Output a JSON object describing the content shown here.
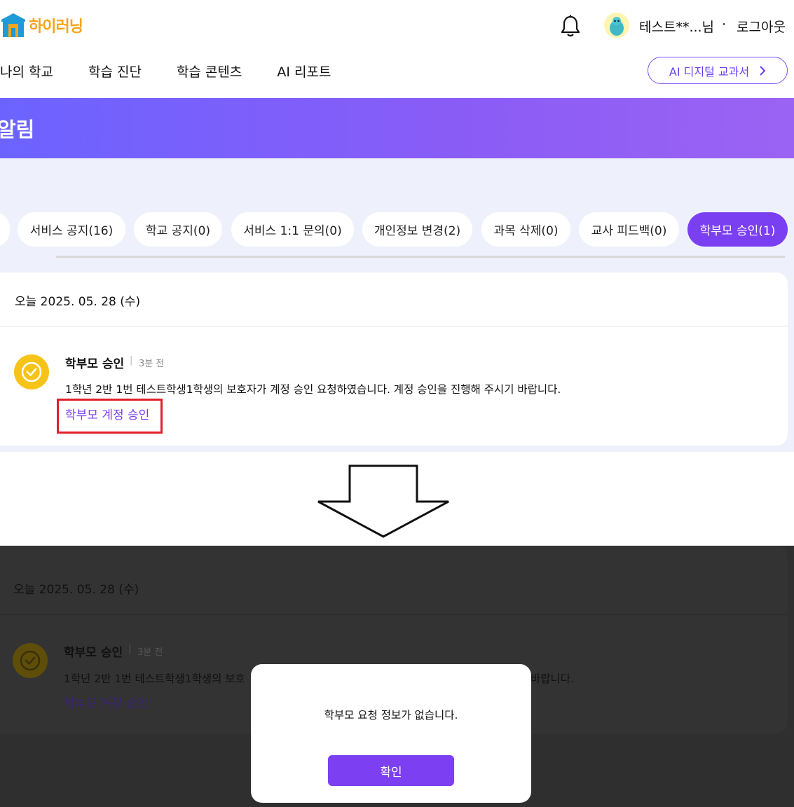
{
  "header": {
    "logo_text": "하이러닝",
    "user_name": "테스트**...님",
    "separator": "·",
    "logout_label": "로그아웃"
  },
  "nav": {
    "items": [
      "나의 학교",
      "학습 진단",
      "학습 콘텐츠",
      "AI 리포트"
    ],
    "ai_textbook_label": "AI 디지털 교과서"
  },
  "banner": {
    "title": "알림"
  },
  "tabs": [
    {
      "label": "서비스 공지(16)",
      "active": false
    },
    {
      "label": "학교 공지(0)",
      "active": false
    },
    {
      "label": "서비스 1:1 문의(0)",
      "active": false
    },
    {
      "label": "개인정보 변경(2)",
      "active": false
    },
    {
      "label": "과목 삭제(0)",
      "active": false
    },
    {
      "label": "교사 피드백(0)",
      "active": false
    },
    {
      "label": "학부모 승인(1)",
      "active": true
    }
  ],
  "notification": {
    "date": "오늘 2025. 05. 28 (수)",
    "title": "학부모 승인",
    "divider": "|",
    "time": "3분 전",
    "body": "1학년 2반 1번 테스트학생1학생의 보호자가 계정 승인 요청하였습니다. 계정 승인을 진행해 주시기 바랍니다.",
    "link_label": "학부모 계정 승인"
  },
  "dimmed": {
    "body_left": "1학년 2반 1번 테스트학생1학생의 보호",
    "body_right": "바랍니다."
  },
  "modal": {
    "message": "학부모 요청 정보가 없습니다.",
    "confirm_label": "확인"
  },
  "colors": {
    "accent": "#7b3ff2",
    "banner_start": "#6c63ff",
    "banner_end": "#9b63f3",
    "check_yellow": "#f6c419",
    "highlight_red": "#e0202a"
  }
}
